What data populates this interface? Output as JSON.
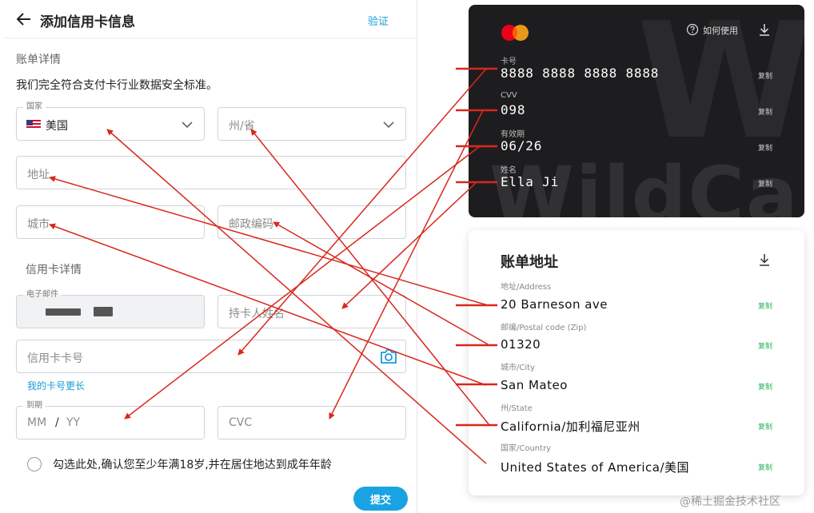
{
  "header": {
    "title": "添加信用卡信息",
    "verify_label": "验证"
  },
  "billing": {
    "section_title": "账单详情",
    "description": "我们完全符合支付卡行业数据安全标准。",
    "country": {
      "label": "国家",
      "value": "美国"
    },
    "state": {
      "placeholder": "州/省"
    },
    "address": {
      "placeholder": "地址"
    },
    "city": {
      "placeholder": "城市"
    },
    "postal": {
      "placeholder": "邮政编码"
    }
  },
  "card_details": {
    "section_title": "信用卡详情",
    "email": {
      "label": "电子邮件"
    },
    "holder": {
      "placeholder": "持卡人姓名"
    },
    "number": {
      "placeholder": "信用卡卡号"
    },
    "longer_link": "我的卡号更长",
    "expiry": {
      "label": "到期",
      "month_placeholder": "MM",
      "separator": "/",
      "year_placeholder": "YY"
    },
    "cvc": {
      "placeholder": "CVC"
    }
  },
  "consent_text": "勾选此处,确认您至少年满18岁,并在居住地达到成年年龄",
  "submit_label": "提交",
  "virtual_card": {
    "how_to_use": "如何使用",
    "watermark": "WildCard",
    "fields": [
      {
        "label": "卡号",
        "value": "8888 8888 8888 8888",
        "copy": "复制"
      },
      {
        "label": "CVV",
        "value": "098",
        "copy": "复制"
      },
      {
        "label": "有效期",
        "value": "06/26",
        "copy": "复制"
      },
      {
        "label": "姓名",
        "value": "Ella Ji",
        "copy": "复制"
      }
    ]
  },
  "billing_address_card": {
    "title": "账单地址",
    "fields": [
      {
        "label": "地址/Address",
        "value": "20 Barneson ave",
        "copy": "复制"
      },
      {
        "label": "邮编/Postal code (Zip)",
        "value": "01320",
        "copy": "复制"
      },
      {
        "label": "城市/City",
        "value": "San Mateo",
        "copy": "复制"
      },
      {
        "label": "州/State",
        "value": "California/加利福尼亚州",
        "copy": "复制"
      },
      {
        "label": "国家/Country",
        "value": "United States of America/美国",
        "copy": "复制"
      }
    ]
  },
  "site_watermark": "@稀土掘金技术社区",
  "colors": {
    "accent": "#19a3e3",
    "arrow": "#d9271c",
    "copy_green": "#27b35a",
    "card_bg": "#1d1d1f"
  }
}
